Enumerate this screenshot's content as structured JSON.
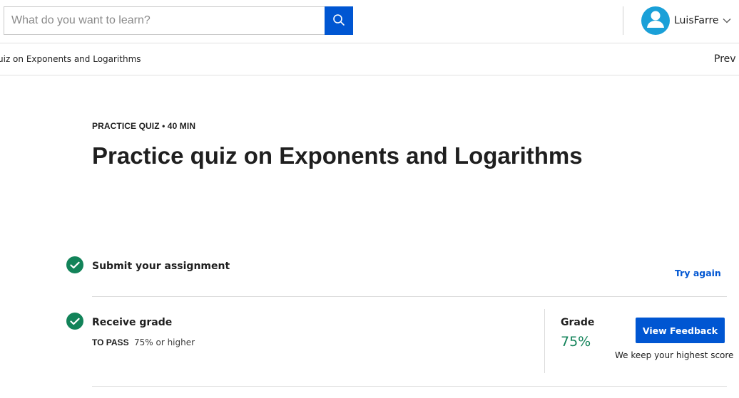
{
  "search": {
    "placeholder": "What do you want to learn?"
  },
  "user": {
    "name": "LuisFarre"
  },
  "breadcrumb": {
    "text": "uiz on Exponents and Logarithms",
    "prev_label": "Prev"
  },
  "quiz": {
    "kicker": "PRACTICE QUIZ • 40 MIN",
    "title": "Practice quiz on Exponents and Logarithms"
  },
  "steps": {
    "submit": {
      "title": "Submit your assignment",
      "action": "Try again"
    },
    "grade": {
      "title": "Receive grade",
      "pass_label": "TO PASS",
      "pass_value": "75% or higher"
    }
  },
  "grade": {
    "label": "Grade",
    "value": "75%",
    "feedback_button": "View Feedback",
    "note": "We keep your highest score"
  },
  "colors": {
    "accent": "#0056d2",
    "success": "#128359",
    "avatar": "#1aa0d8"
  },
  "icons": [
    "search-icon",
    "user-icon",
    "chevron-down-icon",
    "check-icon"
  ]
}
